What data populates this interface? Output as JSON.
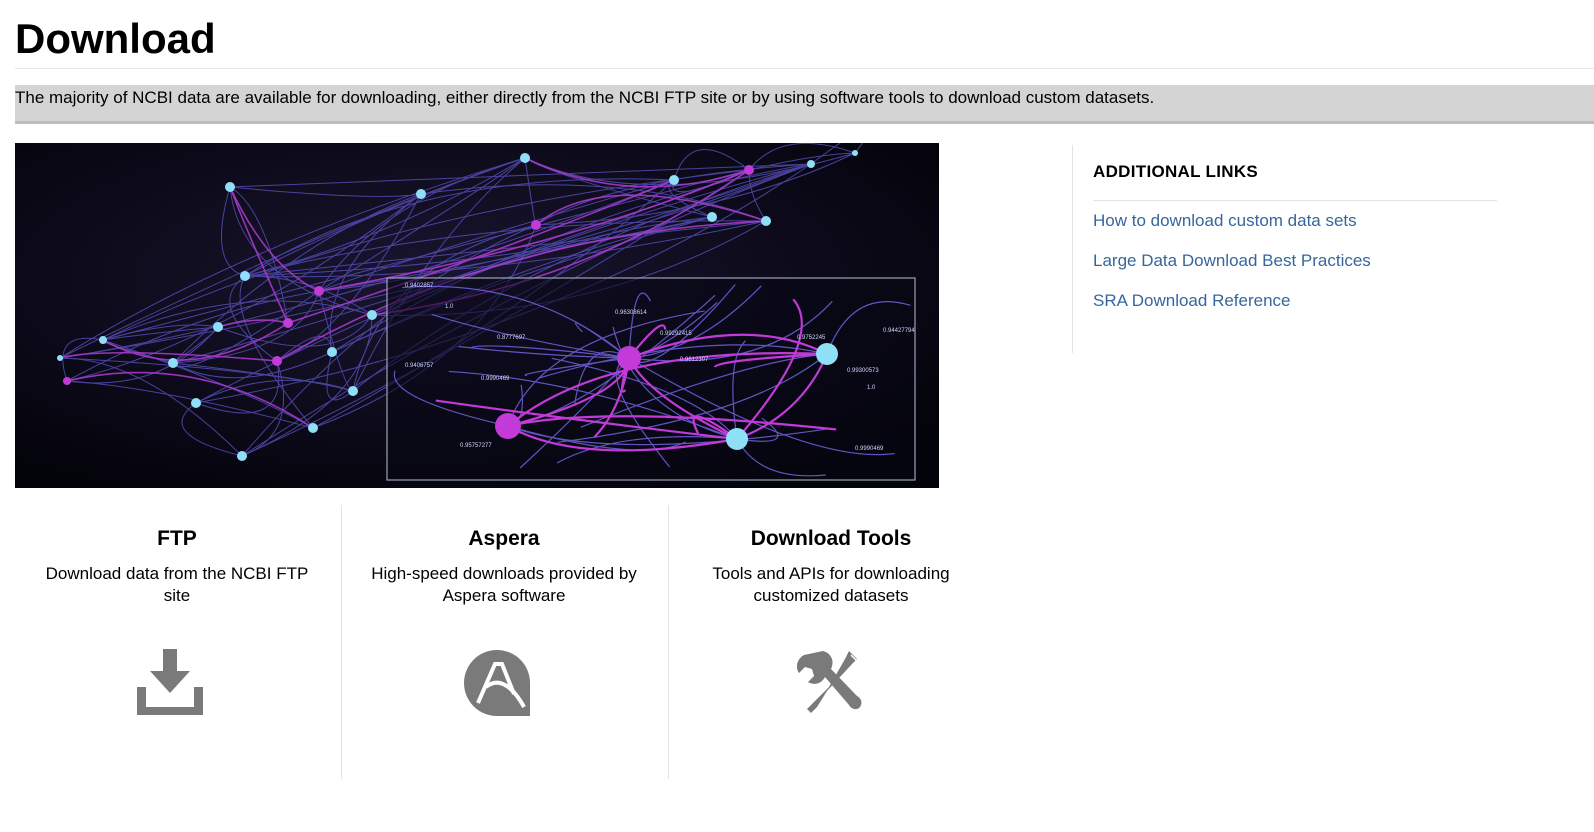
{
  "page": {
    "title": "Download",
    "intro": "The majority of NCBI data are available for downloading, either directly from the NCBI FTP site or by using software tools to download custom datasets."
  },
  "hero_image": {
    "inset_labels": [
      "0.9402857",
      "1.0",
      "0.8777697",
      "0.9406757",
      "0.9990469",
      "0.96308614",
      "0.99292415",
      "0.9612307",
      "0.9752245",
      "0.99300573",
      "1.0",
      "0.94427794",
      "0.95757277",
      "0.9990469"
    ]
  },
  "sidebar": {
    "heading": "ADDITIONAL LINKS",
    "links": [
      {
        "label": "How to download custom data sets"
      },
      {
        "label": "Large Data Download Best Practices"
      },
      {
        "label": "SRA Download Reference"
      }
    ]
  },
  "cards": [
    {
      "title": "FTP",
      "description": "Download data from the NCBI FTP site",
      "icon": "download-icon"
    },
    {
      "title": "Aspera",
      "description": "High-speed downloads provided by Aspera software",
      "icon": "aspera-icon"
    },
    {
      "title": "Download Tools",
      "description": "Tools and APIs for downloading customized datasets",
      "icon": "tools-icon"
    }
  ],
  "colors": {
    "link": "#35669c",
    "intro_band": "#d4d4d4",
    "icon_gray": "#7a7a7a",
    "node_cyan": "#8fe0f7",
    "node_magenta": "#c23ad8",
    "edge_purple": "#6a5bd6"
  }
}
